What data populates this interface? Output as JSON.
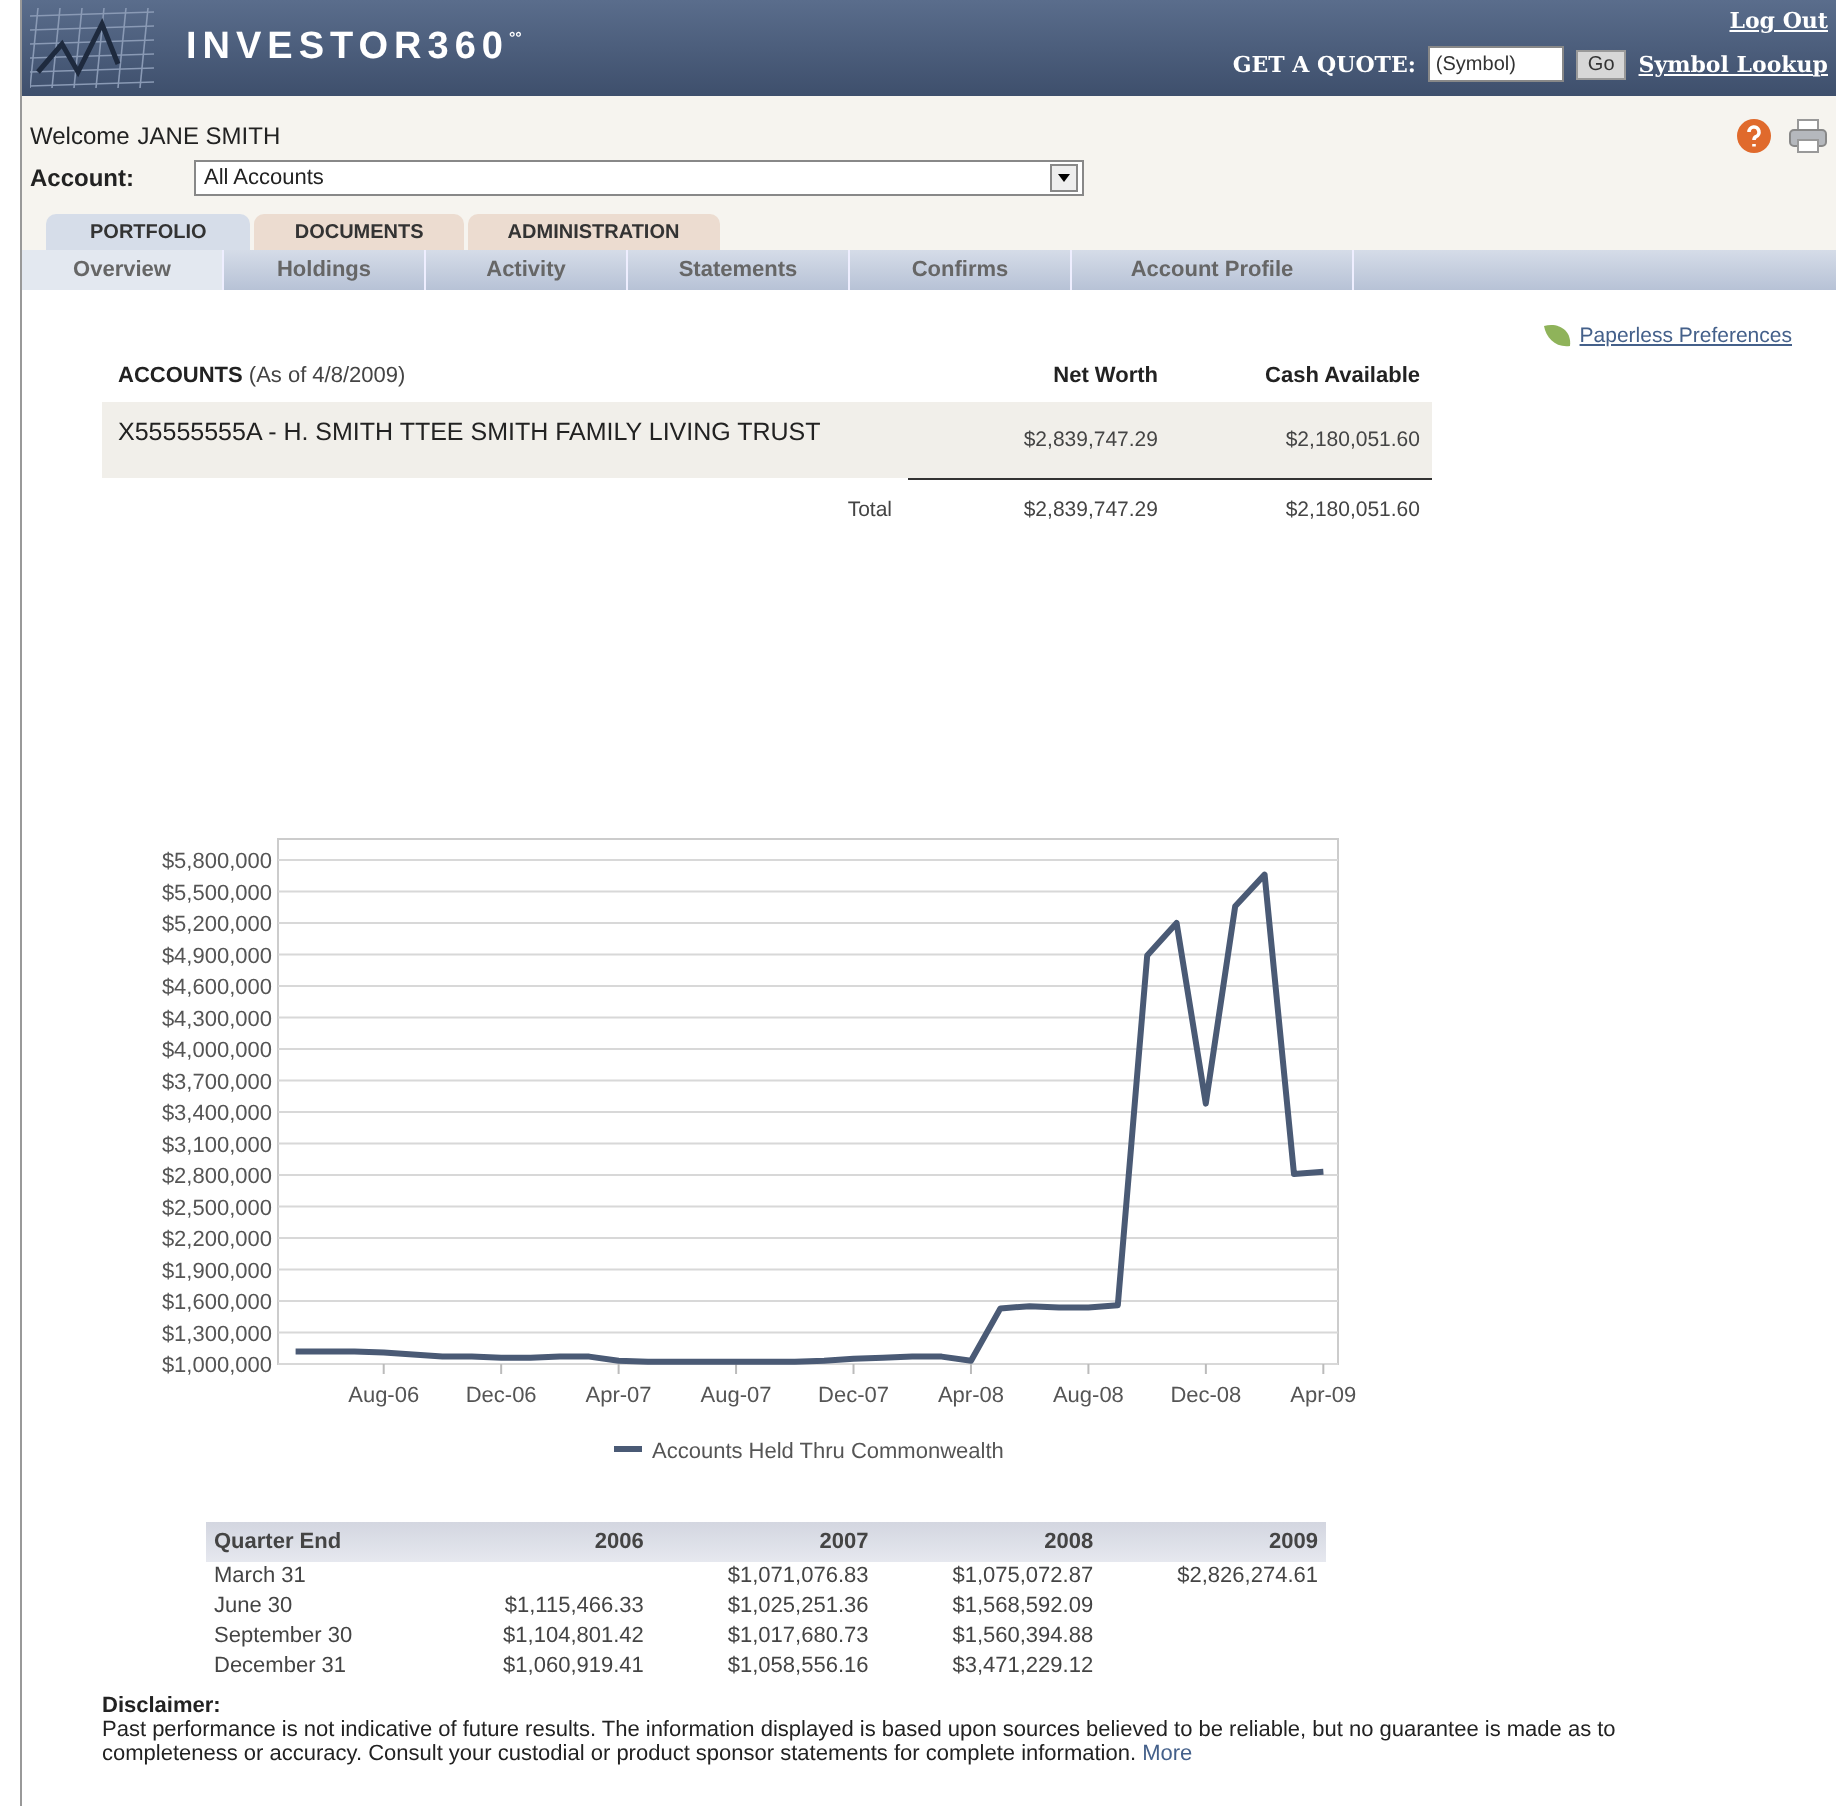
{
  "header": {
    "logo_text": "INVESTOR360$^{°°}$",
    "log_out": "Log Out",
    "quote_label": "GET A QUOTE:",
    "quote_placeholder": "(Symbol)",
    "go": "Go",
    "symbol_lookup": "Symbol Lookup"
  },
  "welcome": {
    "label": "Welcome",
    "name": "JANE SMITH"
  },
  "account": {
    "label": "Account:",
    "value": "All Accounts"
  },
  "tabs": [
    {
      "label": "PORTFOLIO",
      "selected": true
    },
    {
      "label": "DOCUMENTS",
      "selected": false
    },
    {
      "label": "ADMINISTRATION",
      "selected": false
    }
  ],
  "subtabs": [
    {
      "label": "Overview",
      "selected": true
    },
    {
      "label": "Holdings",
      "selected": false
    },
    {
      "label": "Activity",
      "selected": false
    },
    {
      "label": "Statements",
      "selected": false
    },
    {
      "label": "Confirms",
      "selected": false
    },
    {
      "label": "Account Profile",
      "selected": false
    }
  ],
  "paperless_link": "Paperless Preferences",
  "accounts": {
    "title": "ACCOUNTS",
    "as_of": "(As of 4/8/2009)",
    "columns": [
      "Net Worth",
      "Cash Available"
    ],
    "rows": [
      {
        "name": "X55555555A - H. SMITH TTEE SMITH FAMILY LIVING TRUST",
        "values": [
          "$2,839,747.29",
          "$2,180,051.60"
        ]
      }
    ],
    "total_label": "Total",
    "totals": [
      "$2,839,747.29",
      "$2,180,051.60"
    ]
  },
  "chart": {
    "chart_data": {
      "type": "line",
      "categories": [
        null,
        null,
        null,
        "Aug-06",
        null,
        null,
        null,
        "Dec-06",
        null,
        null,
        null,
        "Apr-07",
        null,
        null,
        null,
        "Aug-07",
        null,
        null,
        null,
        "Dec-07",
        null,
        null,
        null,
        "Apr-08",
        null,
        null,
        null,
        "Aug-08",
        null,
        null,
        null,
        "Dec-08",
        null,
        null,
        null,
        "Apr-09"
      ],
      "series": [
        {
          "name": "Accounts Held Thru Commonwealth",
          "color": "#4a5a75",
          "values": [
            1120000,
            1120000,
            1120000,
            1110000,
            1090000,
            1070000,
            1070000,
            1060000,
            1060000,
            1070000,
            1070000,
            1030000,
            1020000,
            1020000,
            1020000,
            1020000,
            1020000,
            1020000,
            1030000,
            1050000,
            1060000,
            1070000,
            1070000,
            1030000,
            1530000,
            1550000,
            1540000,
            1540000,
            1560000,
            4890000,
            5200000,
            3480000,
            5360000,
            5660000,
            2810000,
            2830000
          ]
        }
      ],
      "ylim": [
        1000000,
        6000000
      ],
      "grid": true,
      "yticks": [
        {
          "value": 1000000,
          "label": "$1,000,000"
        },
        {
          "value": 1300000,
          "label": "$1,300,000"
        },
        {
          "value": 1600000,
          "label": "$1,600,000"
        },
        {
          "value": 1900000,
          "label": "$1,900,000"
        },
        {
          "value": 2200000,
          "label": "$2,200,000"
        },
        {
          "value": 2500000,
          "label": "$2,500,000"
        },
        {
          "value": 2800000,
          "label": "$2,800,000"
        },
        {
          "value": 3100000,
          "label": "$3,100,000"
        },
        {
          "value": 3400000,
          "label": "$3,400,000"
        },
        {
          "value": 3700000,
          "label": "$3,700,000"
        },
        {
          "value": 4000000,
          "label": "$4,000,000"
        },
        {
          "value": 4300000,
          "label": "$4,300,000"
        },
        {
          "value": 4600000,
          "label": "$4,600,000"
        },
        {
          "value": 4900000,
          "label": "$4,900,000"
        },
        {
          "value": 5200000,
          "label": "$5,200,000"
        },
        {
          "value": 5500000,
          "label": "$5,500,000"
        },
        {
          "value": 5800000,
          "label": "$5,800,000"
        }
      ]
    }
  },
  "quarters": {
    "label_column": "Quarter End",
    "columns": [
      "2006",
      "2007",
      "2008",
      "2009"
    ],
    "rows": [
      {
        "label": "March 31",
        "cells": [
          {
            "kind": "blank"
          },
          {
            "kind": "amount",
            "value": "$1,071,076.83"
          },
          {
            "kind": "amount",
            "value": "$1,075,072.87"
          },
          {
            "kind": "amount",
            "value": "$2,826,274.61"
          }
        ]
      },
      {
        "label": "June 30",
        "cells": [
          {
            "kind": "amount",
            "value": "$1,115,466.33"
          },
          {
            "kind": "amount",
            "value": "$1,025,251.36"
          },
          {
            "kind": "amount",
            "value": "$1,568,592.09"
          }
        ]
      },
      {
        "label": "September 30",
        "cells": [
          {
            "kind": "amount",
            "value": "$1,104,801.42"
          },
          {
            "kind": "amount",
            "value": "$1,017,680.73"
          },
          {
            "kind": "amount",
            "value": "$1,560,394.88"
          }
        ]
      },
      {
        "label": "December 31",
        "cells": [
          {
            "kind": "amount",
            "value": "$1,060,919.41"
          },
          {
            "kind": "amount",
            "value": "$1,058,556.16"
          },
          {
            "kind": "amount",
            "value": "$3,471,229.12"
          }
        ]
      }
    ]
  },
  "disclaimer": {
    "title": "Disclaimer:",
    "text": "Past performance is not indicative of future results. The information displayed is based upon sources believed to be reliable, but no guarantee is made as to completeness or accuracy. Consult your custodial or product sponsor statements for complete information.",
    "link": "More"
  }
}
